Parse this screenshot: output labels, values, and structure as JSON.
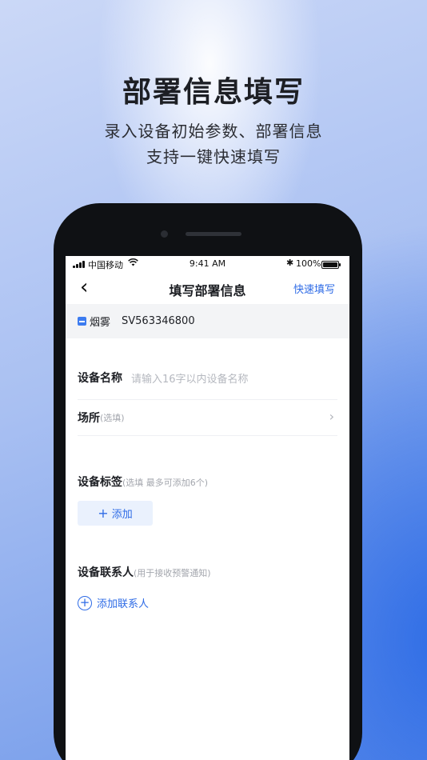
{
  "hero": {
    "title": "部署信息填写",
    "subtitle_line1": "录入设备初始参数、部署信息",
    "subtitle_line2": "支持一键快速填写"
  },
  "status_bar": {
    "carrier": "中国移动",
    "time": "9:41 AM",
    "battery": "100%"
  },
  "nav": {
    "back_icon": "‹",
    "title": "填写部署信息",
    "action": "快速填写"
  },
  "device": {
    "type": "烟雾",
    "serial": "SV563346800"
  },
  "form": {
    "name_label": "设备名称",
    "name_placeholder": "请输入16字以内设备名称",
    "place_label": "场所",
    "place_optional": "(选填)",
    "tags_label": "设备标签",
    "tags_hint": "(选填 最多可添加6个)",
    "add_tag": "添加",
    "contacts_label": "设备联系人",
    "contacts_hint": "(用于接收预警通知)",
    "add_contact": "添加联系人"
  },
  "colors": {
    "accent": "#2e6be6",
    "tag_bg": "#eaf1fd"
  }
}
